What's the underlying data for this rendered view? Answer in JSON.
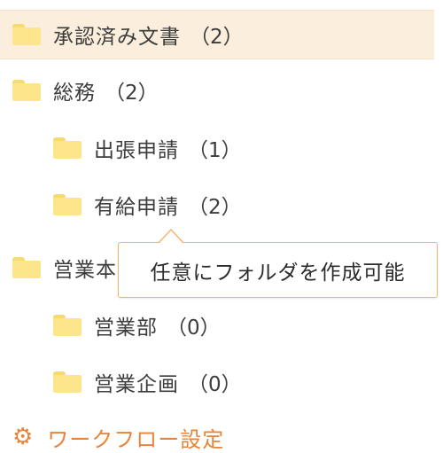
{
  "folders": [
    {
      "label": "承認済み文書",
      "count": "（2）"
    },
    {
      "label": "総務",
      "count": "（2）"
    },
    {
      "label": "出張申請",
      "count": "（1）"
    },
    {
      "label": "有給申請",
      "count": "（2）"
    },
    {
      "label": "営業本部",
      "count": ""
    },
    {
      "label": "営業部",
      "count": "（0）"
    },
    {
      "label": "営業企画",
      "count": "（0）"
    }
  ],
  "tooltip": {
    "text": "任意にフォルダを作成可能"
  },
  "footer": {
    "workflow_label": "ワークフロー設定",
    "icon": "gear-icon"
  },
  "colors": {
    "accent": "#e8843a",
    "folder": "#fce58a",
    "selected_bg": "#fbeedd",
    "tooltip_border": "#f5b268"
  }
}
